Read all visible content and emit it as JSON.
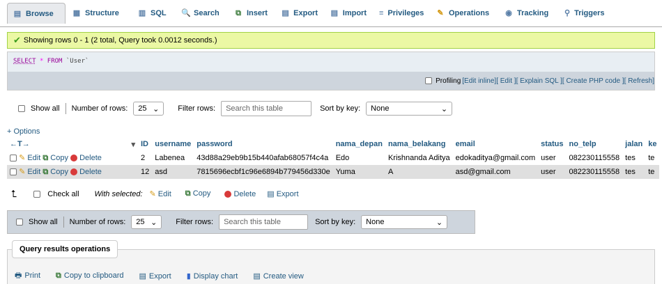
{
  "tabs": [
    {
      "label": "Browse",
      "icon": "browse-icon"
    },
    {
      "label": "Structure",
      "icon": "structure-icon"
    },
    {
      "label": "SQL",
      "icon": "sql-icon"
    },
    {
      "label": "Search",
      "icon": "search-icon"
    },
    {
      "label": "Insert",
      "icon": "insert-icon"
    },
    {
      "label": "Export",
      "icon": "export-icon"
    },
    {
      "label": "Import",
      "icon": "import-icon"
    },
    {
      "label": "Privileges",
      "icon": "privileges-icon"
    },
    {
      "label": "Operations",
      "icon": "operations-icon"
    },
    {
      "label": "Tracking",
      "icon": "tracking-icon"
    },
    {
      "label": "Triggers",
      "icon": "triggers-icon"
    }
  ],
  "success": {
    "message": "Showing rows 0 - 1 (2 total, Query took 0.0012 seconds.)"
  },
  "sql": {
    "keyword": "SELECT",
    "star": "*",
    "from": "FROM",
    "table": "`User`",
    "profiling": "Profiling",
    "edit_inline": "[Edit inline]",
    "edit": "[ Edit ]",
    "explain": "[ Explain SQL ]",
    "php": "[ Create PHP code ]",
    "refresh": "[ Refresh]"
  },
  "nav": {
    "show_all": "Show all",
    "num_rows_label": "Number of rows:",
    "num_rows_value": "25",
    "filter_label": "Filter rows:",
    "filter_placeholder": "Search this table",
    "sort_label": "Sort by key:",
    "sort_value": "None"
  },
  "options_link": "+ Options",
  "table": {
    "columns": [
      "ID",
      "username",
      "password",
      "nama_depan",
      "nama_belakang",
      "email",
      "status",
      "no_telp",
      "jalan",
      "ke"
    ],
    "rows": [
      {
        "id": "2",
        "username": "Labenea",
        "password": "43d88a29eb9b15b440afab68057f4c4a",
        "nama_depan": "Edo",
        "nama_belakang": "Krishnanda Aditya",
        "email": "edokaditya@gmail.com",
        "status": "user",
        "no_telp": "082230115558",
        "jalan": "tes",
        "ke": "te"
      },
      {
        "id": "12",
        "username": "asd",
        "password": "7815696ecbf1c96e6894b779456d330e",
        "nama_depan": "Yuma",
        "nama_belakang": "A",
        "email": "asd@gmail.com",
        "status": "user",
        "no_telp": "082230115558",
        "jalan": "tes",
        "ke": "te"
      }
    ],
    "row_actions": {
      "edit": "Edit",
      "copy": "Copy",
      "delete": "Delete"
    }
  },
  "bulk": {
    "check_all": "Check all",
    "with_selected": "With selected:",
    "edit": "Edit",
    "copy": "Copy",
    "delete": "Delete",
    "export": "Export"
  },
  "qro": {
    "title": "Query results operations",
    "print": "Print",
    "copy_clipboard": "Copy to clipboard",
    "export": "Export",
    "display_chart": "Display chart",
    "create_view": "Create view"
  }
}
